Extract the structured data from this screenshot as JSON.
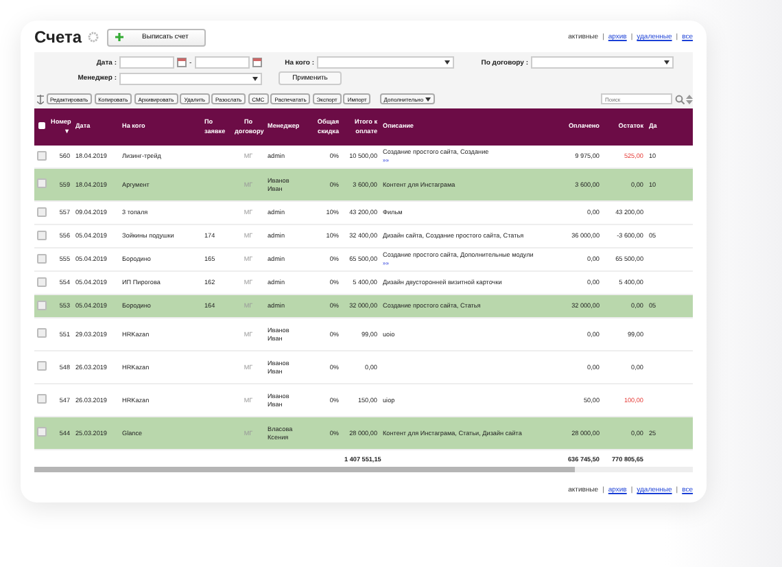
{
  "title": "Счета",
  "link_separator": "|",
  "create_button": "Выписать счет",
  "views_top": [
    {
      "label": "активные",
      "selected": true
    },
    {
      "label": "архив",
      "selected": false
    },
    {
      "label": "удаленные",
      "selected": false
    },
    {
      "label": "все",
      "selected": false
    }
  ],
  "filters": {
    "date_label": "Дата :",
    "date_separator": "-",
    "payer_label": "На кого :",
    "contract_label": "По договору :",
    "manager_label": "Менеджер :",
    "apply_button": "Применить"
  },
  "toolbar": {
    "actions": [
      "Редактировать",
      "Копировать",
      "Архивировать",
      "Удалить",
      "Разослать",
      "СМС",
      "Распечатать",
      "Экспорт",
      "Импорт"
    ],
    "more": "Дополнительно",
    "search_placeholder": "Поиск"
  },
  "all_checked": false,
  "columns": [
    {
      "label": "Номер",
      "sort_mark": "▼"
    },
    {
      "label": "Дата"
    },
    {
      "label": "На кого"
    },
    {
      "label": "По заявке"
    },
    {
      "label": "По договору"
    },
    {
      "label": "Менеджер"
    },
    {
      "label": "Общая скидка"
    },
    {
      "label": "Итого к оплате"
    },
    {
      "label": "Описание"
    },
    {
      "label": "Оплачено"
    },
    {
      "label": "Остаток"
    },
    {
      "label": "Да"
    }
  ],
  "rows": [
    {
      "cells": [
        "560",
        "18.04.2019",
        "Лизинг-трейд",
        "",
        "МГ",
        "admin",
        "0%",
        "10 500,00",
        "Создание простого сайта, Создание",
        "9 975,00",
        "525,00",
        "10"
      ],
      "more_link": "»»",
      "highlighted": false,
      "checked": false,
      "overdue": true
    },
    {
      "cells": [
        "559",
        "18.04.2019",
        "Аргумент",
        "",
        "МГ",
        "Иванов Иван",
        "0%",
        "3 600,00",
        "Контент для Инстаграма",
        "3 600,00",
        "0,00",
        "10"
      ],
      "highlighted": true,
      "checked": false,
      "overdue": false
    },
    {
      "cells": [
        "557",
        "09.04.2019",
        "3 топаля",
        "",
        "МГ",
        "admin",
        "10%",
        "43 200,00",
        "Фильм",
        "0,00",
        "43 200,00",
        ""
      ],
      "highlighted": false,
      "checked": false,
      "overdue": false
    },
    {
      "cells": [
        "556",
        "05.04.2019",
        "Зойкины подушки",
        "174",
        "МГ",
        "admin",
        "10%",
        "32 400,00",
        "Дизайн сайта, Создание простого сайта, Статья",
        "36 000,00",
        "-3 600,00",
        "05"
      ],
      "highlighted": false,
      "checked": false,
      "overdue": false
    },
    {
      "cells": [
        "555",
        "05.04.2019",
        "Бородино",
        "165",
        "МГ",
        "admin",
        "0%",
        "65 500,00",
        "Создание простого сайта, Дополнительные модули",
        "0,00",
        "65 500,00",
        ""
      ],
      "more_link": "»»",
      "highlighted": false,
      "checked": false,
      "overdue": false
    },
    {
      "cells": [
        "554",
        "05.04.2019",
        "ИП Пирогова",
        "162",
        "МГ",
        "admin",
        "0%",
        "5 400,00",
        "Дизайн двусторонней визитной карточки",
        "0,00",
        "5 400,00",
        ""
      ],
      "highlighted": false,
      "checked": false,
      "overdue": false
    },
    {
      "cells": [
        "553",
        "05.04.2019",
        "Бородино",
        "164",
        "МГ",
        "admin",
        "0%",
        "32 000,00",
        "Создание простого сайта, Статья",
        "32 000,00",
        "0,00",
        "05"
      ],
      "highlighted": true,
      "checked": false,
      "overdue": false
    },
    {
      "cells": [
        "551",
        "29.03.2019",
        "HRKazan",
        "",
        "МГ",
        "Иванов Иван",
        "0%",
        "99,00",
        "uoio",
        "0,00",
        "99,00",
        ""
      ],
      "highlighted": false,
      "checked": false,
      "overdue": false
    },
    {
      "cells": [
        "548",
        "26.03.2019",
        "HRKazan",
        "",
        "МГ",
        "Иванов Иван",
        "0%",
        "0,00",
        "",
        "0,00",
        "0,00",
        ""
      ],
      "highlighted": false,
      "checked": false,
      "overdue": false
    },
    {
      "cells": [
        "547",
        "26.03.2019",
        "HRKazan",
        "",
        "МГ",
        "Иванов Иван",
        "0%",
        "150,00",
        "uiop",
        "50,00",
        "100,00",
        ""
      ],
      "highlighted": false,
      "checked": false,
      "overdue": true
    },
    {
      "cells": [
        "544",
        "25.03.2019",
        "Glance",
        "",
        "МГ",
        "Власова Ксения",
        "0%",
        "28 000,00",
        "Контент для Инстаграма, Статьи, Дизайн сайта",
        "28 000,00",
        "0,00",
        "25"
      ],
      "highlighted": true,
      "checked": false,
      "overdue": false
    }
  ],
  "totals": {
    "total": "1 407 551,15",
    "paid": "636 745,50",
    "remainder": "770 805,65"
  },
  "views_bottom": [
    {
      "label": "активные",
      "selected": true
    },
    {
      "label": "архив",
      "selected": false
    },
    {
      "label": "удаленные",
      "selected": false
    },
    {
      "label": "все",
      "selected": false
    }
  ]
}
